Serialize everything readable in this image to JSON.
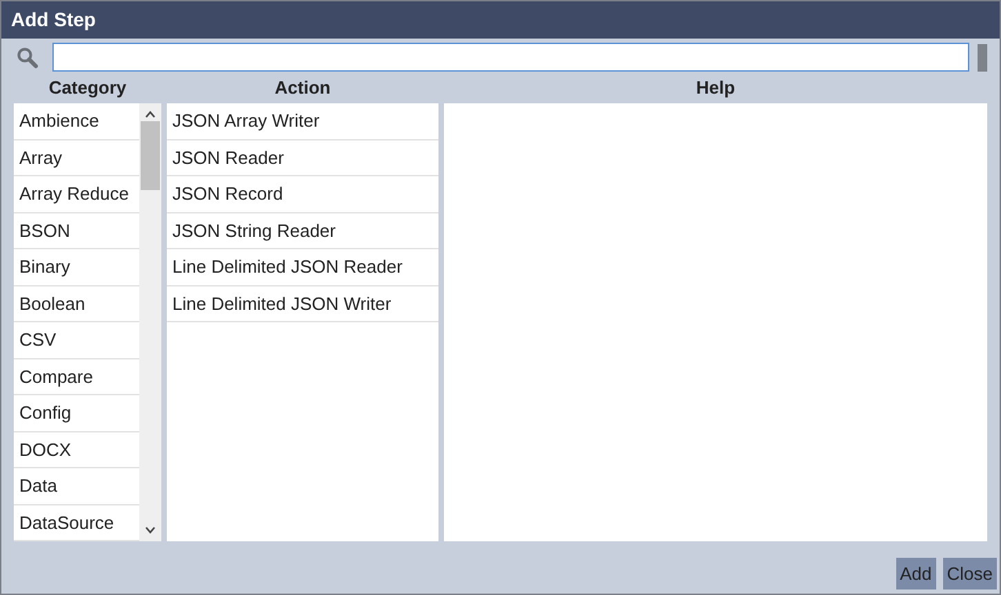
{
  "window": {
    "title": "Add Step"
  },
  "columns": [
    "Category",
    "Action",
    "Help"
  ],
  "categories": [
    "Ambience",
    "Array",
    "Array Reduce",
    "BSON",
    "Binary",
    "Boolean",
    "CSV",
    "Compare",
    "Config",
    "DOCX",
    "Data",
    "DataSource"
  ],
  "actions": [
    "JSON Array Writer",
    "JSON Reader",
    "JSON Record",
    "JSON String Reader",
    "Line Delimited JSON Reader",
    "Line Delimited JSON Writer"
  ],
  "buttons": [
    "Add",
    "Close"
  ]
}
